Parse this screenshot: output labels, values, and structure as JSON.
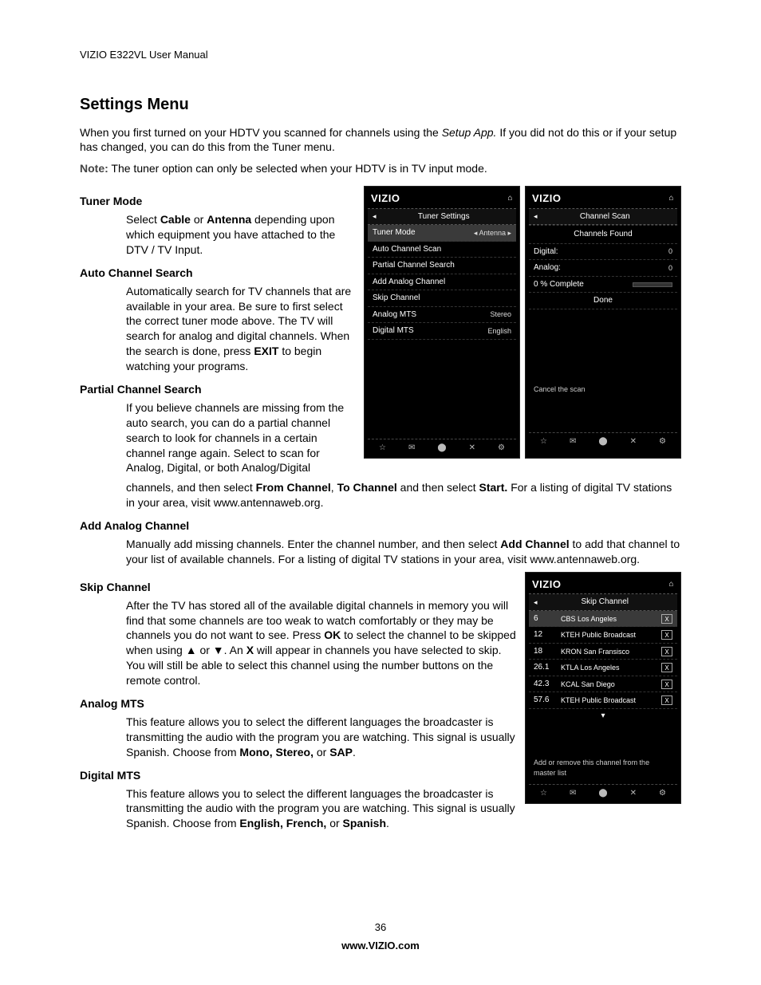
{
  "header": "VIZIO E322VL User Manual",
  "title": "Settings Menu",
  "intro1_a": "When you first turned on your HDTV you scanned for channels using the ",
  "intro1_b": "Setup App.",
  "intro1_c": " If you did not do this or if your setup has changed, you can do this from the Tuner menu.",
  "note_label": "Note:",
  "note_text": " The tuner option can only be selected when your HDTV is in TV input mode.",
  "s1_h": "Tuner Mode",
  "s1_a": "Select ",
  "s1_b": "Cable",
  "s1_c": " or ",
  "s1_d": "Antenna",
  "s1_e": " depending upon which equipment you have attached to the DTV / TV Input.",
  "s2_h": "Auto Channel Search",
  "s2_a": "Automatically search for TV channels that are available in your area. Be sure to first select the correct tuner mode above. The TV will search for analog and digital channels. When the search is done, press ",
  "s2_b": "EXIT",
  "s2_c": " to begin watching your programs.",
  "s3_h": "Partial Channel Search",
  "s3_a": "If you believe channels are missing from the auto search, you can do a partial channel search to look for channels in a certain channel range again. Select to scan for Analog, Digital, or both Analog/Digital ",
  "s3_cont_a": "channels, and then select ",
  "s3_cont_b": "From Channel",
  "s3_cont_c": ", ",
  "s3_cont_d": "To Channel",
  "s3_cont_e": " and then select ",
  "s3_cont_f": "Start.",
  "s3_cont_g": " For a listing of digital TV stations in your area, visit www.antennaweb.org.",
  "s4_h": "Add Analog Channel",
  "s4_a": "Manually add missing channels. Enter the channel number, and then select ",
  "s4_b": "Add Channel",
  "s4_c": " to add that channel to your list of available channels. For a listing of digital TV stations in your area, visit www.antennaweb.org.",
  "s5_h": "Skip Channel",
  "s5_a": "After the TV has stored all of the available digital channels in memory you will find that some channels are too weak to watch comfortably or they may be channels you do not want to see. Press ",
  "s5_b": "OK",
  "s5_c": " to select the channel to be skipped when using ▲ or ▼. An ",
  "s5_d": "X",
  "s5_e": " will appear in channels you have selected to skip. You will still be able to select this channel using the number buttons on the remote control.",
  "s6_h": "Analog MTS",
  "s6_a": "This feature allows you to select the different languages the broadcaster is transmitting the audio with the program you are watching. This signal is usually Spanish. Choose from ",
  "s6_b": "Mono, Stereo,",
  "s6_c": " or ",
  "s6_d": "SAP",
  "s6_e": ".",
  "s7_h": "Digital MTS",
  "s7_a": "This feature allows you to select the different languages the broadcaster is transmitting the audio with the program you are watching. This signal is usually Spanish. Choose from ",
  "s7_b": "English, French,",
  "s7_c": " or ",
  "s7_d": "Spanish",
  "s7_e": ".",
  "page_number": "36",
  "site": "www.VIZIO.com",
  "tv": {
    "brand": "VIZIO",
    "home": "⌂",
    "tuner": {
      "title": "Tuner Settings",
      "rows": [
        {
          "l": "Tuner Mode",
          "r": "◂ Antenna ▸",
          "hl": true
        },
        {
          "l": "Auto Channel Scan",
          "r": ""
        },
        {
          "l": "Partial Channel Search",
          "r": ""
        },
        {
          "l": "Add Analog Channel",
          "r": ""
        },
        {
          "l": "Skip Channel",
          "r": ""
        },
        {
          "l": "Analog MTS",
          "r": "Stereo"
        },
        {
          "l": "Digital MTS",
          "r": "English"
        }
      ]
    },
    "scan": {
      "title": "Channel Scan",
      "found": "Channels Found",
      "digital_l": "Digital:",
      "digital_v": "0",
      "analog_l": "Analog:",
      "analog_v": "0",
      "percent": "0 % Complete",
      "done": "Done",
      "cancel": "Cancel the scan"
    },
    "skip": {
      "title": "Skip Channel",
      "rows": [
        {
          "n": "6",
          "name": "CBS Los Angeles"
        },
        {
          "n": "12",
          "name": "KTEH Public Broadcast"
        },
        {
          "n": "18",
          "name": "KRON San Fransisco"
        },
        {
          "n": "26.1",
          "name": "KTLA Los Angeles"
        },
        {
          "n": "42.3",
          "name": "KCAL San Diego"
        },
        {
          "n": "57.6",
          "name": "KTEH Public Broadcast"
        }
      ],
      "hint": "Add or remove this channel from the master list"
    },
    "ficons": [
      "☆",
      "✉",
      "⬤",
      "✕",
      "⚙"
    ]
  }
}
